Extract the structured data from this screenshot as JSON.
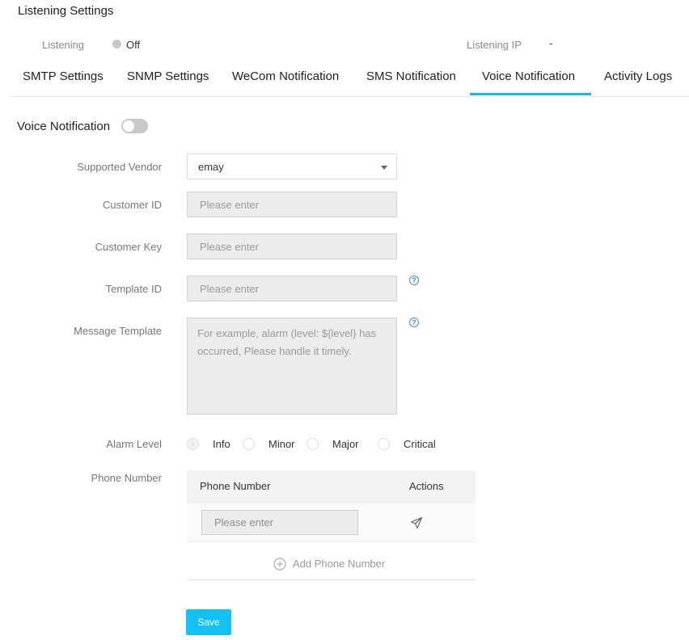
{
  "listening_settings": {
    "title": "Listening Settings",
    "listening_label": "Listening",
    "listening_status": "Off",
    "listening_ip_label": "Listening IP",
    "listening_ip_value": "-"
  },
  "tabs": [
    {
      "label": "SMTP Settings"
    },
    {
      "label": "SNMP Settings"
    },
    {
      "label": "WeCom Notification"
    },
    {
      "label": "SMS Notification"
    },
    {
      "label": "Voice Notification",
      "active": true
    },
    {
      "label": "Activity Logs"
    }
  ],
  "voice": {
    "title": "Voice Notification",
    "enabled": false,
    "vendor_label": "Supported Vendor",
    "vendor_value": "emay",
    "customer_id_label": "Customer ID",
    "customer_id_placeholder": "Please enter",
    "customer_key_label": "Customer Key",
    "customer_key_placeholder": "Please enter",
    "template_id_label": "Template ID",
    "template_id_placeholder": "Please enter",
    "message_template_label": "Message Template",
    "message_template_placeholder": "For example, alarm (level: ${level} has occurred, Please handle it timely.",
    "alarm_level_label": "Alarm Level",
    "alarm_levels": [
      {
        "label": "Info",
        "checked": true,
        "disabled": true
      },
      {
        "label": "Minor",
        "checked": false
      },
      {
        "label": "Major",
        "checked": false
      },
      {
        "label": "Critical",
        "checked": false
      }
    ],
    "phone_number_label": "Phone Number",
    "phone_table": {
      "col_phone": "Phone Number",
      "col_actions": "Actions",
      "row_placeholder": "Please enter"
    },
    "add_phone_label": "Add Phone Number",
    "save_label": "Save"
  },
  "icons": {
    "help": "help-circle-icon",
    "send": "send-icon",
    "add": "plus-circle-icon",
    "caret": "caret-down-icon"
  },
  "colors": {
    "accent": "#14b9e6",
    "save_button": "#13c2f2",
    "help_icon": "#3d8ed8"
  }
}
